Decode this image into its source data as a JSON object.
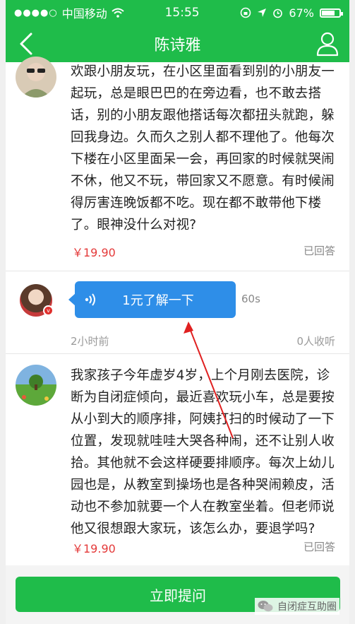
{
  "status_bar": {
    "carrier": "中国移动",
    "time": "15:55",
    "battery": "67%"
  },
  "nav": {
    "title": "陈诗雅"
  },
  "questions": [
    {
      "text": "欢跟小朋友玩，在小区里面看到别的小朋友一起玩，总是眼巴巴的在旁边看，也不敢去搭话，别的小朋友跟他搭话每次都扭头就跑，躲回我身边。久而久之别人都不理他了。他每次下楼在小区里面呆一会，再回家的时候就哭闹不休，他又不玩，带回家又不愿意。有时候闹得厉害连晚饭都不吃。现在都不敢带他下楼了。眼神没什么对视?",
      "price": "￥19.90",
      "status": "已回答"
    },
    {
      "text": "我家孩子今年虚岁4岁，上个月刚去医院，诊断为自闭症倾向，最近喜欢玩小车，总是要按从小到大的顺序排，阿姨打扫的时候动了一下位置，发现就哇哇大哭各种闹，还不让别人收拾。其他就不会这样硬要排顺序。每次上幼儿园也是，从教室到操场也是各种哭闹赖皮，活动也不参加就要一个人在教室坐着。但老师说他又很想跟大家玩，该怎么办，要退学吗?",
      "price": "￥19.90",
      "status": "已回答"
    }
  ],
  "voice_answer": {
    "bubble_label": "1元了解一下",
    "duration": "60s",
    "time_ago": "2小时前",
    "listeners": "0人收听"
  },
  "ask_button": {
    "label": "立即提问"
  },
  "watermark": {
    "text": "自闭症互助圈"
  },
  "colors": {
    "brand_green": "#1fbc4a",
    "voice_blue": "#2e8ee8",
    "price_red": "#e43a3a",
    "annotation_red": "#e02020"
  }
}
